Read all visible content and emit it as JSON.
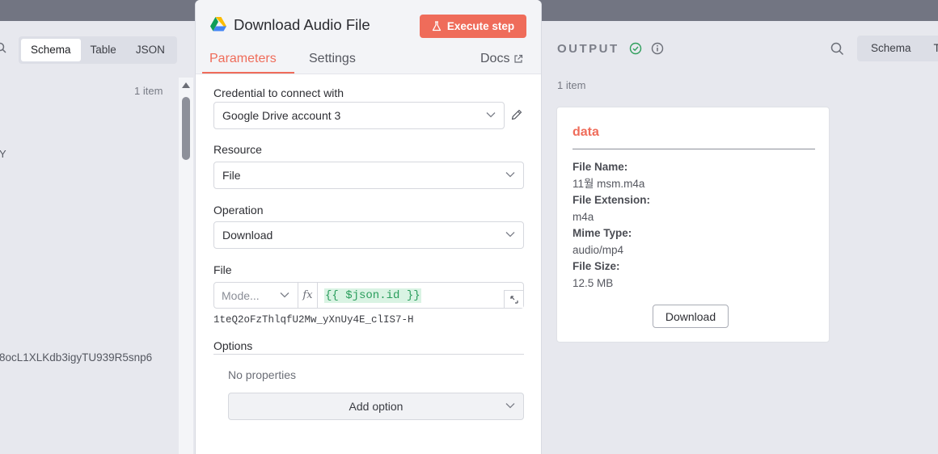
{
  "left_panel": {
    "views": [
      "Schema",
      "Table",
      "JSON"
    ],
    "active_view": "Schema",
    "item_count": "1 item",
    "partial_letter": "Y",
    "partial_id": "8ocL1XLKdb3igyTU939R5snp6"
  },
  "node": {
    "title": "Download Audio File",
    "execute_label": "Execute step",
    "tabs": {
      "parameters": "Parameters",
      "settings": "Settings"
    },
    "docs_label": "Docs",
    "credential": {
      "label": "Credential to connect with",
      "value": "Google Drive account 3"
    },
    "resource": {
      "label": "Resource",
      "value": "File"
    },
    "operation": {
      "label": "Operation",
      "value": "Download"
    },
    "file": {
      "label": "File",
      "mode_placeholder": "Mode...",
      "fx_label": "fx",
      "expression": "{{ $json.id }}",
      "resolved": "1teQ2oFzThlqfU2Mw_yXnUy4E_clIS7-H"
    },
    "options": {
      "label": "Options",
      "empty_text": "No properties",
      "add_label": "Add option"
    }
  },
  "output": {
    "title": "OUTPUT",
    "views": [
      "Schema",
      "T"
    ],
    "item_count": "1 item",
    "card": {
      "title": "data",
      "fields": [
        {
          "key": "File Name:",
          "value": "11월 msm.m4a"
        },
        {
          "key": "File Extension:",
          "value": "m4a"
        },
        {
          "key": "Mime Type:",
          "value": "audio/mp4"
        },
        {
          "key": "File Size:",
          "value": "12.5 MB"
        }
      ],
      "download_label": "Download"
    }
  },
  "colors": {
    "accent": "#ef6c5a",
    "success": "#2e9e5b",
    "expression": "#2a9d5c"
  }
}
